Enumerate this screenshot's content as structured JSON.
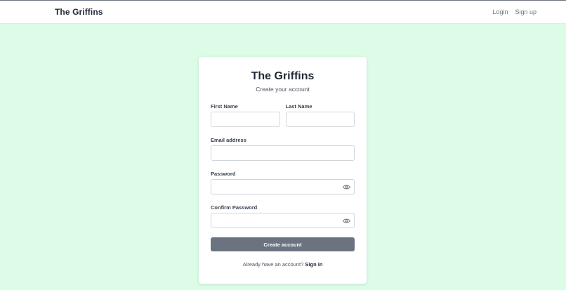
{
  "navbar": {
    "brand": "The Griffins",
    "login": "Login",
    "signup": "Sign up"
  },
  "card": {
    "title": "The Griffins",
    "subtitle": "Create your account",
    "first_name_label": "First Name",
    "first_name_value": "",
    "last_name_label": "Last Name",
    "last_name_value": "",
    "email_label": "Email address",
    "email_value": "",
    "password_label": "Password",
    "password_value": "",
    "confirm_label": "Confirm Password",
    "confirm_value": "",
    "submit_label": "Create account",
    "footer_prefix": "Already have an account?",
    "footer_link": "Sign in"
  },
  "colors": {
    "page_background": "#dcfce7",
    "button": "#6b7280"
  },
  "icons": {
    "password_toggle": "eye-icon",
    "confirm_toggle": "eye-icon"
  }
}
